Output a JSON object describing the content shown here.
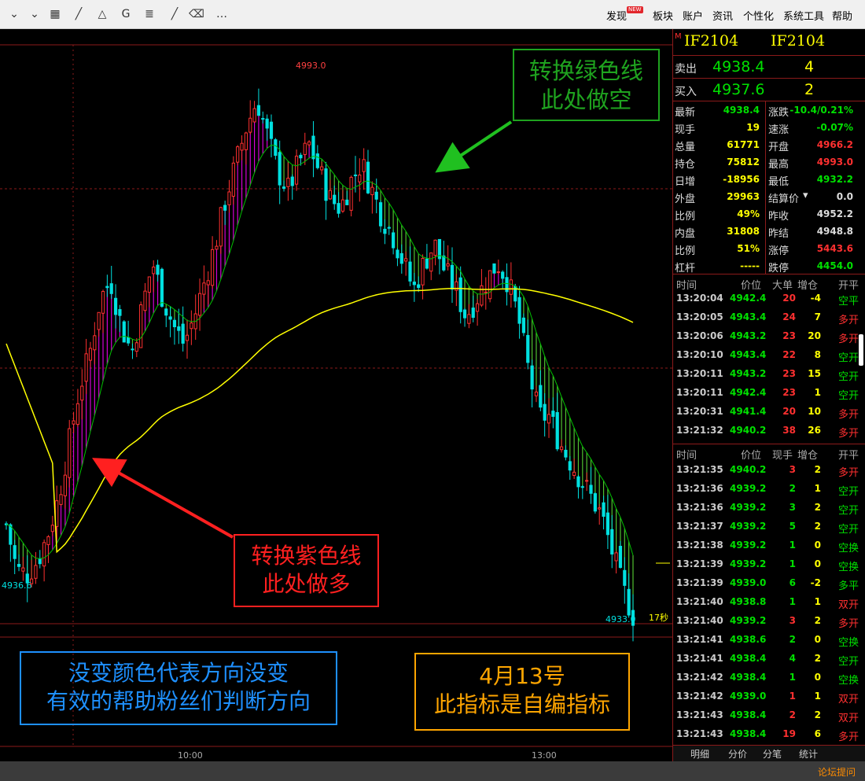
{
  "toolbar": {
    "icons": [
      "chevron-double-down-icon",
      "chevron-down-icon",
      "grid-table-icon",
      "draw-line-icon",
      "draw-triangle-icon",
      "draw-text-icon",
      "draw-doc-icon",
      "eraser-icon",
      "more-icon"
    ],
    "icon_glyphs": [
      "⌄",
      "⌄",
      "▦",
      "╱",
      "△",
      "G",
      "≣",
      "⌫",
      "…"
    ],
    "new_badge": "NEW",
    "menu": [
      "发现",
      "板块",
      "账户",
      "资讯",
      "个性化",
      "系统工具",
      "帮助"
    ]
  },
  "chart_data": {
    "type": "candlestick",
    "title": "",
    "xlabel": "",
    "ylabel": "",
    "x_ticks": [
      "10:00",
      "13:00"
    ],
    "price_labels": {
      "high": "4993.0",
      "low_left": "4936.6",
      "low_right": "4933.0"
    },
    "timeframe_label": "17秒",
    "ylim": [
      4933.0,
      4993.0
    ],
    "colors": {
      "up": "#ff3030",
      "down": "#00e0e0",
      "avg_line": "#ffff00",
      "green_line": "#00c000",
      "magenta_fill": "#d400d4",
      "green_fill": "#50c030"
    },
    "approx_close_path": [
      4943,
      4938,
      4937.5,
      4939,
      4942,
      4946,
      4952,
      4958,
      4962,
      4968,
      4970,
      4965,
      4962,
      4967,
      4972,
      4968,
      4965,
      4963,
      4966,
      4970,
      4974,
      4979,
      4983,
      4987,
      4990,
      4986,
      4982,
      4980,
      4983,
      4985,
      4982,
      4979,
      4978,
      4981,
      4983,
      4980,
      4977,
      4975,
      4972,
      4969,
      4972,
      4974,
      4971,
      4969,
      4966,
      4968,
      4970,
      4972,
      4970,
      4966,
      4960,
      4955,
      4955,
      4952,
      4950,
      4948,
      4946,
      4944,
      4940,
      4936,
      4933
    ]
  },
  "annotations": {
    "green": {
      "line1": "转换绿色线",
      "line2": "此处做空"
    },
    "red": {
      "line1": "转换紫色线",
      "line2": "此处做多"
    },
    "blue": {
      "line1": "没变颜色代表方向没变",
      "line2": "有效的帮助粉丝们判断方向"
    },
    "orange": {
      "line1": "4月13号",
      "line2": "此指标是自编指标"
    }
  },
  "panel": {
    "m_badge": "M",
    "code_left": "IF2104",
    "code_right": "IF2104",
    "ask": {
      "label": "卖出",
      "price": "4938.4",
      "vol": "4"
    },
    "bid": {
      "label": "买入",
      "price": "4937.6",
      "vol": "2"
    },
    "stats_left": [
      {
        "label": "最新",
        "value": "4938.4",
        "color": "#00e000"
      },
      {
        "label": "现手",
        "value": "19",
        "color": "#ffff00"
      },
      {
        "label": "总量",
        "value": "61771",
        "color": "#ffff00"
      },
      {
        "label": "持仓",
        "value": "75812",
        "color": "#ffff00"
      },
      {
        "label": "日增",
        "value": "-18956",
        "color": "#ffff00"
      },
      {
        "label": "外盘",
        "value": "29963",
        "color": "#ffff00"
      },
      {
        "label": "比例",
        "value": "49%",
        "color": "#ffff00"
      },
      {
        "label": "内盘",
        "value": "31808",
        "color": "#ffff00"
      },
      {
        "label": "比例",
        "value": "51%",
        "color": "#ffff00"
      },
      {
        "label": "杠杆",
        "value": "-----",
        "color": "#ffff00"
      }
    ],
    "stats_right": [
      {
        "label": "涨跌",
        "value": "-10.4/0.21%",
        "color": "#00e000"
      },
      {
        "label": "速涨",
        "value": "-0.07%",
        "color": "#00e000"
      },
      {
        "label": "开盘",
        "value": "4966.2",
        "color": "#ff3030"
      },
      {
        "label": "最高",
        "value": "4993.0",
        "color": "#ff3030"
      },
      {
        "label": "最低",
        "value": "4932.2",
        "color": "#00e000"
      },
      {
        "label": "结算价",
        "value": "0.0",
        "color": "#dddddd"
      },
      {
        "label": "昨收",
        "value": "4952.2",
        "color": "#dddddd"
      },
      {
        "label": "昨结",
        "value": "4948.8",
        "color": "#dddddd"
      },
      {
        "label": "涨停",
        "value": "5443.6",
        "color": "#ff3030"
      },
      {
        "label": "跌停",
        "value": "4454.0",
        "color": "#00e000"
      }
    ],
    "settle_dropdown_glyph": "▾",
    "big_head": [
      "时间",
      "价位",
      "大单",
      "增仓",
      "开平"
    ],
    "big_trades": [
      {
        "time": "13:20:04",
        "price": "4942.4",
        "vol": "20",
        "chg": "-4",
        "kind": "空平",
        "kc": "#00e000"
      },
      {
        "time": "13:20:05",
        "price": "4943.4",
        "vol": "24",
        "chg": "7",
        "kind": "多开",
        "kc": "#ff3030"
      },
      {
        "time": "13:20:06",
        "price": "4943.2",
        "vol": "23",
        "chg": "20",
        "kind": "多开",
        "kc": "#ff3030"
      },
      {
        "time": "13:20:10",
        "price": "4943.4",
        "vol": "22",
        "chg": "8",
        "kind": "空开",
        "kc": "#00e000"
      },
      {
        "time": "13:20:11",
        "price": "4943.2",
        "vol": "23",
        "chg": "15",
        "kind": "空开",
        "kc": "#00e000"
      },
      {
        "time": "13:20:11",
        "price": "4942.4",
        "vol": "23",
        "chg": "1",
        "kind": "空开",
        "kc": "#00e000"
      },
      {
        "time": "13:20:31",
        "price": "4941.4",
        "vol": "20",
        "chg": "10",
        "kind": "多开",
        "kc": "#ff3030"
      },
      {
        "time": "13:21:32",
        "price": "4940.2",
        "vol": "38",
        "chg": "26",
        "kind": "多开",
        "kc": "#ff3030"
      }
    ],
    "tick_head": [
      "时间",
      "价位",
      "现手",
      "增仓",
      "开平"
    ],
    "ticks": [
      {
        "time": "13:21:35",
        "price": "4940.2",
        "vol": "3",
        "vc": "#ff3030",
        "chg": "2",
        "kind": "多开",
        "kc": "#ff3030"
      },
      {
        "time": "13:21:36",
        "price": "4939.2",
        "vol": "2",
        "vc": "#00e000",
        "chg": "1",
        "kind": "空开",
        "kc": "#00e000"
      },
      {
        "time": "13:21:36",
        "price": "4939.2",
        "vol": "3",
        "vc": "#00e000",
        "chg": "2",
        "kind": "空开",
        "kc": "#00e000"
      },
      {
        "time": "13:21:37",
        "price": "4939.2",
        "vol": "5",
        "vc": "#00e000",
        "chg": "2",
        "kind": "空开",
        "kc": "#00e000"
      },
      {
        "time": "13:21:38",
        "price": "4939.2",
        "vol": "1",
        "vc": "#00e000",
        "chg": "0",
        "kind": "空换",
        "kc": "#00e000"
      },
      {
        "time": "13:21:39",
        "price": "4939.2",
        "vol": "1",
        "vc": "#00e000",
        "chg": "0",
        "kind": "空换",
        "kc": "#00e000"
      },
      {
        "time": "13:21:39",
        "price": "4939.0",
        "vol": "6",
        "vc": "#00e000",
        "chg": "-2",
        "kind": "多平",
        "kc": "#00e000"
      },
      {
        "time": "13:21:40",
        "price": "4938.8",
        "vol": "1",
        "vc": "#00e000",
        "chg": "1",
        "kind": "双开",
        "kc": "#ff3030"
      },
      {
        "time": "13:21:40",
        "price": "4939.2",
        "vol": "3",
        "vc": "#ff3030",
        "chg": "2",
        "kind": "多开",
        "kc": "#ff3030"
      },
      {
        "time": "13:21:41",
        "price": "4938.6",
        "vol": "2",
        "vc": "#00e000",
        "chg": "0",
        "kind": "空换",
        "kc": "#00e000"
      },
      {
        "time": "13:21:41",
        "price": "4938.4",
        "vol": "4",
        "vc": "#00e000",
        "chg": "2",
        "kind": "空开",
        "kc": "#00e000"
      },
      {
        "time": "13:21:42",
        "price": "4938.4",
        "vol": "1",
        "vc": "#00e000",
        "chg": "0",
        "kind": "空换",
        "kc": "#00e000"
      },
      {
        "time": "13:21:42",
        "price": "4939.0",
        "vol": "1",
        "vc": "#ff3030",
        "chg": "1",
        "kind": "双开",
        "kc": "#ff3030"
      },
      {
        "time": "13:21:43",
        "price": "4938.4",
        "vol": "2",
        "vc": "#ff3030",
        "chg": "2",
        "kind": "双开",
        "kc": "#ff3030"
      },
      {
        "time": "13:21:43",
        "price": "4938.4",
        "vol": "19",
        "vc": "#ff3030",
        "chg": "6",
        "kind": "多开",
        "kc": "#ff3030"
      }
    ],
    "tabs": [
      "明细",
      "分价",
      "分笔",
      "统计"
    ]
  },
  "status": {
    "forum": "论坛提问"
  }
}
